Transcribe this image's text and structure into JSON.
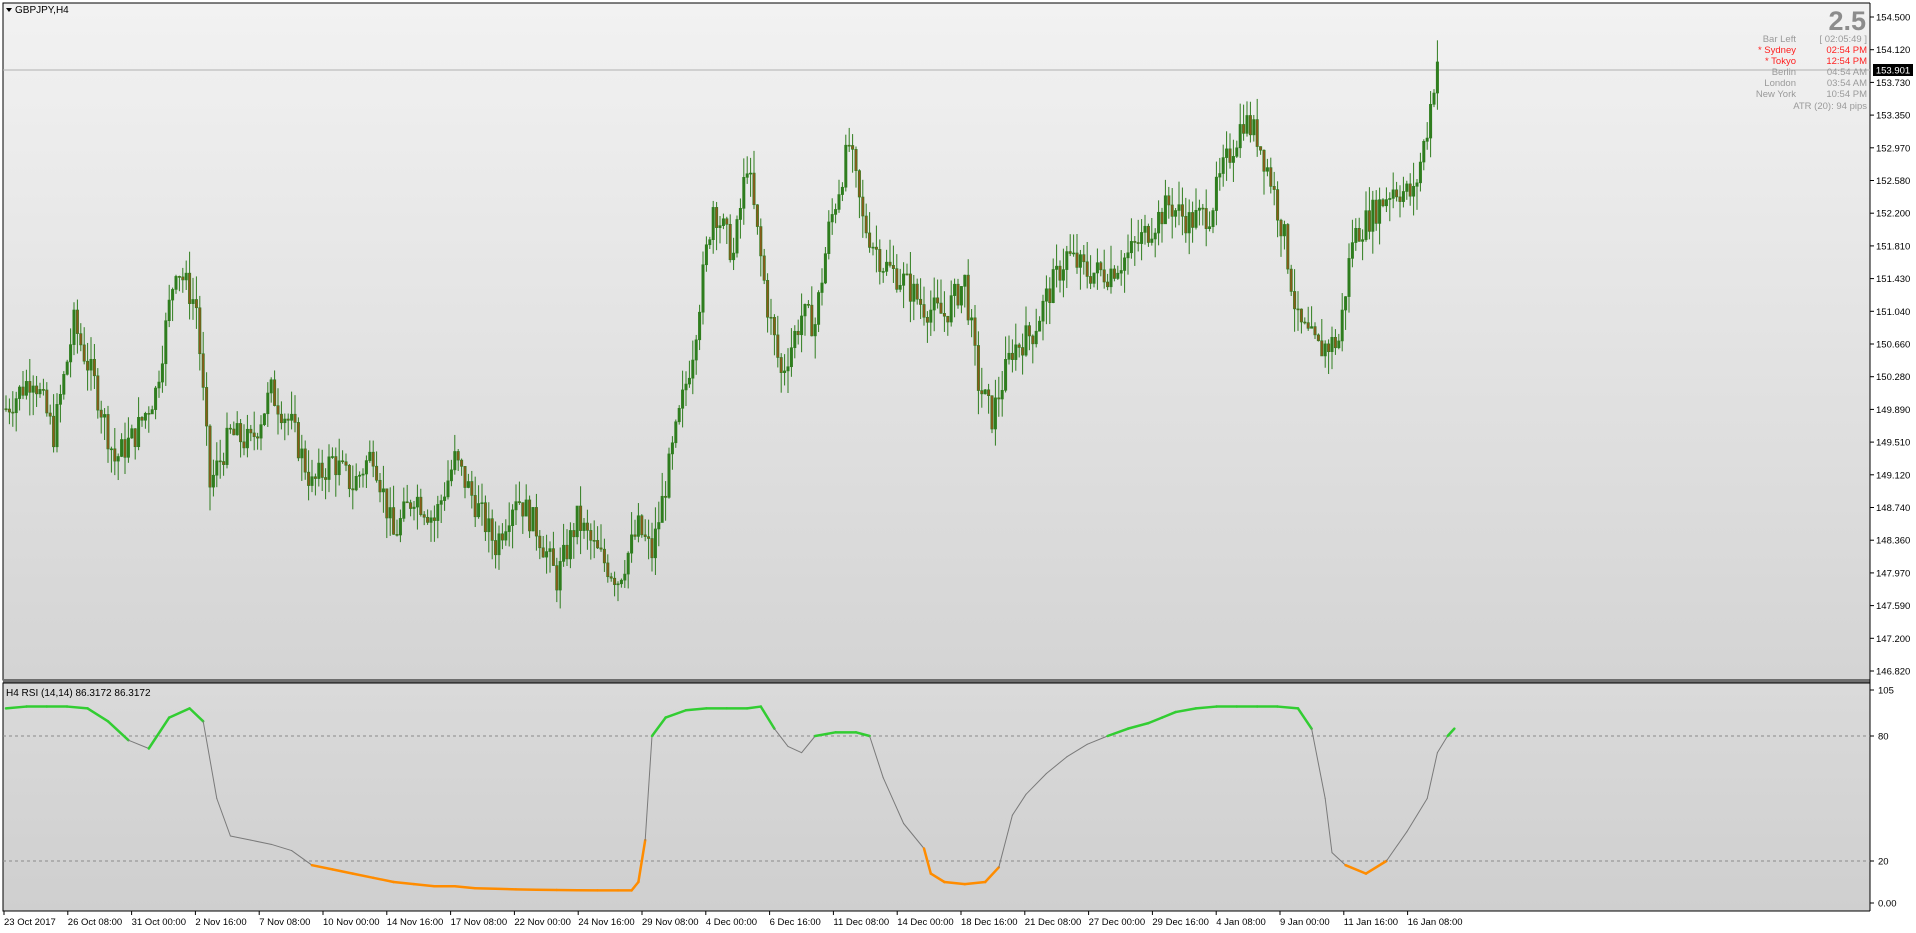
{
  "window": {
    "symbol_title": "GBPJPY,H4"
  },
  "corner_value": "2.5",
  "info_panel": {
    "bar_left_label": "Bar Left",
    "bar_left_value": "[ 02:05:49 ]",
    "rows": [
      {
        "name": "* Sydney",
        "time": "02:54 PM",
        "color": "#ff2020"
      },
      {
        "name": "* Tokyo",
        "time": "12:54 PM",
        "color": "#ff2020"
      },
      {
        "name": "Berlin",
        "time": "04:54 AM",
        "color": "#9a9a9a"
      },
      {
        "name": "London",
        "time": "03:54 AM",
        "color": "#9a9a9a"
      },
      {
        "name": "New York",
        "time": "10:54 PM",
        "color": "#9a9a9a"
      }
    ],
    "atr_text": "ATR (20): 94 pips"
  },
  "current_price": "153.901",
  "indicator": {
    "label": "H4 RSI (14,14) 86.3172 86.3172"
  },
  "colors": {
    "candle": "#2f7d1e",
    "candle_bear_body": "#8a5a1a",
    "rsi_up": "#32cd32",
    "rsi_down": "#ff8c00",
    "rsi_mid": "#7a7a7a"
  },
  "chart_data": [
    {
      "type": "candlestick",
      "title": "GBPJPY,H4",
      "y_ticks": [
        "154.500",
        "154.120",
        "153.730",
        "153.350",
        "152.970",
        "152.580",
        "152.200",
        "151.810",
        "151.430",
        "151.040",
        "150.660",
        "150.280",
        "149.890",
        "149.510",
        "149.120",
        "148.740",
        "148.360",
        "147.970",
        "147.590",
        "147.200",
        "146.820"
      ],
      "ylim": [
        146.82,
        154.5
      ],
      "x_tick_labels": [
        "23 Oct 2017",
        "26 Oct 08:00",
        "31 Oct 00:00",
        "2 Nov 16:00",
        "7 Nov 08:00",
        "10 Nov 00:00",
        "14 Nov 16:00",
        "17 Nov 08:00",
        "22 Nov 00:00",
        "24 Nov 16:00",
        "29 Nov 08:00",
        "4 Dec 00:00",
        "6 Dec 16:00",
        "11 Dec 08:00",
        "14 Dec 00:00",
        "18 Dec 16:00",
        "21 Dec 08:00",
        "27 Dec 00:00",
        "29 Dec 16:00",
        "4 Jan 08:00",
        "9 Jan 00:00",
        "11 Jan 16:00",
        "16 Jan 08:00"
      ],
      "price_path": [
        [
          0,
          149.9
        ],
        [
          8,
          150.3
        ],
        [
          14,
          149.6
        ],
        [
          20,
          150.9
        ],
        [
          26,
          150.2
        ],
        [
          32,
          149.3
        ],
        [
          38,
          149.6
        ],
        [
          44,
          150.1
        ],
        [
          50,
          151.6
        ],
        [
          56,
          151.1
        ],
        [
          60,
          149.0
        ],
        [
          66,
          149.6
        ],
        [
          72,
          149.5
        ],
        [
          78,
          150.1
        ],
        [
          84,
          149.7
        ],
        [
          90,
          149.0
        ],
        [
          96,
          149.3
        ],
        [
          102,
          149.0
        ],
        [
          108,
          149.4
        ],
        [
          114,
          148.4
        ],
        [
          120,
          148.9
        ],
        [
          126,
          148.6
        ],
        [
          132,
          149.3
        ],
        [
          138,
          148.8
        ],
        [
          144,
          148.3
        ],
        [
          150,
          148.9
        ],
        [
          156,
          148.5
        ],
        [
          162,
          147.9
        ],
        [
          168,
          148.6
        ],
        [
          174,
          148.2
        ],
        [
          180,
          147.9
        ],
        [
          186,
          148.5
        ],
        [
          190,
          148.2
        ],
        [
          196,
          149.4
        ],
        [
          202,
          150.6
        ],
        [
          208,
          152.3
        ],
        [
          214,
          151.7
        ],
        [
          218,
          152.8
        ],
        [
          224,
          151.1
        ],
        [
          228,
          150.3
        ],
        [
          234,
          151.0
        ],
        [
          238,
          150.9
        ],
        [
          242,
          152.0
        ],
        [
          248,
          153.0
        ],
        [
          252,
          152.1
        ],
        [
          258,
          151.6
        ],
        [
          264,
          151.4
        ],
        [
          270,
          151.1
        ],
        [
          276,
          151.0
        ],
        [
          282,
          151.4
        ],
        [
          286,
          150.2
        ],
        [
          290,
          149.8
        ],
        [
          296,
          150.6
        ],
        [
          302,
          150.8
        ],
        [
          306,
          151.2
        ],
        [
          312,
          151.7
        ],
        [
          318,
          151.5
        ],
        [
          324,
          151.5
        ],
        [
          330,
          151.7
        ],
        [
          336,
          152.0
        ],
        [
          342,
          152.3
        ],
        [
          348,
          152.1
        ],
        [
          354,
          152.2
        ],
        [
          358,
          152.7
        ],
        [
          364,
          153.3
        ],
        [
          368,
          153.1
        ],
        [
          372,
          152.6
        ],
        [
          376,
          151.9
        ],
        [
          380,
          150.9
        ],
        [
          386,
          150.6
        ],
        [
          392,
          150.7
        ],
        [
          396,
          151.9
        ],
        [
          402,
          152.2
        ],
        [
          408,
          152.5
        ],
        [
          414,
          152.4
        ],
        [
          418,
          153.2
        ],
        [
          421,
          154.0
        ]
      ]
    },
    {
      "type": "line",
      "title": "H4 RSI (14,14)",
      "y_ticks": [
        "105",
        "80",
        "20",
        "0.00"
      ],
      "ylim": [
        0,
        105
      ],
      "levels": [
        80,
        20
      ],
      "rsi_points": [
        [
          0,
          95
        ],
        [
          6,
          96
        ],
        [
          12,
          96
        ],
        [
          18,
          96
        ],
        [
          24,
          95
        ],
        [
          30,
          88
        ],
        [
          36,
          78
        ],
        [
          42,
          74
        ],
        [
          48,
          90
        ],
        [
          54,
          95
        ],
        [
          58,
          88
        ],
        [
          62,
          50
        ],
        [
          66,
          32
        ],
        [
          72,
          30
        ],
        [
          78,
          28
        ],
        [
          84,
          25
        ],
        [
          90,
          18
        ],
        [
          96,
          16
        ],
        [
          102,
          14
        ],
        [
          108,
          12
        ],
        [
          114,
          10
        ],
        [
          120,
          9
        ],
        [
          126,
          8
        ],
        [
          132,
          8
        ],
        [
          138,
          7
        ],
        [
          144,
          6.8
        ],
        [
          150,
          6.5
        ],
        [
          156,
          6.3
        ],
        [
          162,
          6.2
        ],
        [
          168,
          6.1
        ],
        [
          174,
          6
        ],
        [
          180,
          6
        ],
        [
          184,
          6
        ],
        [
          186,
          10
        ],
        [
          188,
          30
        ],
        [
          190,
          80
        ],
        [
          194,
          90
        ],
        [
          200,
          94
        ],
        [
          206,
          95
        ],
        [
          212,
          95
        ],
        [
          218,
          95
        ],
        [
          222,
          96
        ],
        [
          226,
          84
        ],
        [
          230,
          75
        ],
        [
          234,
          72
        ],
        [
          238,
          80
        ],
        [
          244,
          82
        ],
        [
          250,
          82
        ],
        [
          254,
          80
        ],
        [
          258,
          60
        ],
        [
          264,
          38
        ],
        [
          270,
          26
        ],
        [
          272,
          14
        ],
        [
          276,
          10
        ],
        [
          282,
          9
        ],
        [
          288,
          10
        ],
        [
          292,
          17
        ],
        [
          296,
          42
        ],
        [
          300,
          52
        ],
        [
          306,
          62
        ],
        [
          312,
          70
        ],
        [
          318,
          76
        ],
        [
          324,
          80
        ],
        [
          330,
          84
        ],
        [
          336,
          87
        ],
        [
          340,
          90
        ],
        [
          344,
          93
        ],
        [
          350,
          95
        ],
        [
          356,
          96
        ],
        [
          362,
          96
        ],
        [
          368,
          96
        ],
        [
          374,
          96
        ],
        [
          380,
          95
        ],
        [
          384,
          84
        ],
        [
          388,
          50
        ],
        [
          390,
          24
        ],
        [
          394,
          18
        ],
        [
          400,
          14
        ],
        [
          406,
          20
        ],
        [
          412,
          34
        ],
        [
          418,
          50
        ],
        [
          421,
          72
        ],
        [
          424,
          80
        ],
        [
          426,
          84
        ]
      ]
    }
  ]
}
